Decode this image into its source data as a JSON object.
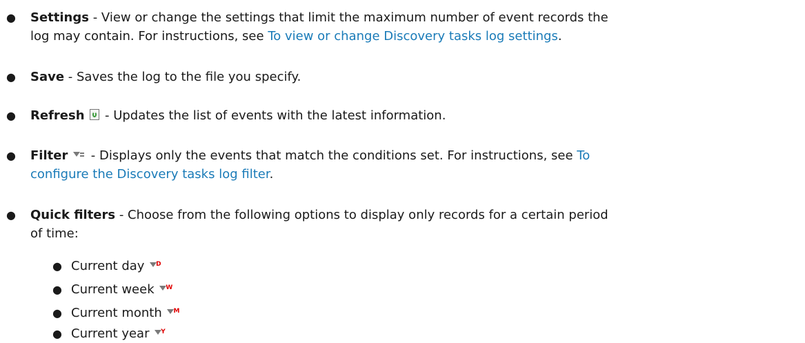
{
  "items": [
    {
      "title": "Settings",
      "line1": " - View or change the settings that limit the maximum number of event records the",
      "line2_text": "log may contain. For instructions, see ",
      "link": "To view or change Discovery tasks log settings",
      "line2_tail": "."
    },
    {
      "title": "Save",
      "text": " - Saves the log to the file you specify."
    },
    {
      "title": "Refresh",
      "icon": "refresh-icon",
      "text": " - Updates the list of events with the latest information."
    },
    {
      "title": "Filter",
      "icon": "filter-icon",
      "line1": " - Displays only the events that match the conditions set. For instructions, see ",
      "link_part1": "To",
      "link_part2": "configure the Discovery tasks log filter",
      "line2_tail": "."
    },
    {
      "title": "Quick filters",
      "line1": " - Choose from the following options to display only records for a certain period",
      "line2": "of time:"
    }
  ],
  "quick_filters": [
    {
      "label": "Current day",
      "icon": "quick-filter-day-icon",
      "letter": "D"
    },
    {
      "label": "Current week",
      "icon": "quick-filter-week-icon",
      "letter": "W"
    },
    {
      "label": "Current month",
      "icon": "quick-filter-month-icon",
      "letter": "M"
    },
    {
      "label": "Current year",
      "icon": "quick-filter-year-icon",
      "letter": "Y"
    }
  ],
  "colors": {
    "link": "#1a7bb8",
    "text": "#1a1a1a",
    "quick_filter_letter": "#e00000"
  }
}
